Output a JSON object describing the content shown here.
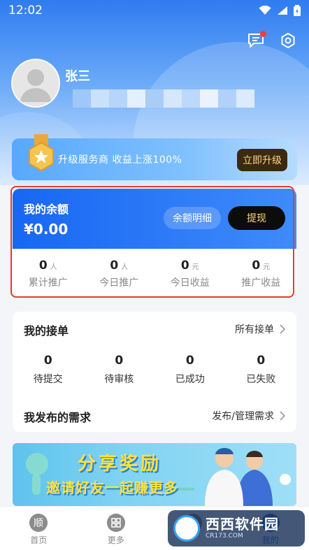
{
  "status_bar": {
    "time": "12:02"
  },
  "profile": {
    "name": "张三"
  },
  "upgrade": {
    "text": "升级服务商 收益上涨100%",
    "button": "立即升级"
  },
  "balance": {
    "title": "我的余额",
    "amount": "¥0.00",
    "detail_button": "余额明细",
    "withdraw_button": "提现",
    "stats": [
      {
        "value": "0",
        "unit": "人",
        "label": "累计推广"
      },
      {
        "value": "0",
        "unit": "人",
        "label": "今日推广"
      },
      {
        "value": "0",
        "unit": "元",
        "label": "今日收益"
      },
      {
        "value": "0",
        "unit": "元",
        "label": "推广收益"
      }
    ]
  },
  "orders": {
    "title": "我的接单",
    "all_link": "所有接单",
    "stats": [
      {
        "value": "0",
        "label": "待提交"
      },
      {
        "value": "0",
        "label": "待审核"
      },
      {
        "value": "0",
        "label": "已成功"
      },
      {
        "value": "0",
        "label": "已失败"
      }
    ],
    "needs_title": "我发布的需求",
    "needs_link": "发布/管理需求"
  },
  "banner": {
    "title": "分享奖励",
    "subtitle": "邀请好友一起赚更多"
  },
  "tabbar": {
    "items": [
      {
        "label": "首页",
        "icon": "home-icon"
      },
      {
        "label": "更多",
        "icon": "grid-icon"
      },
      {
        "label": "",
        "icon": "task-icon"
      },
      {
        "label": "我的",
        "icon": "user-icon"
      }
    ]
  },
  "watermark": {
    "text": "西西软件园",
    "sub": "CR173.COM"
  },
  "colors": {
    "primary": "#2f7cf0",
    "card_blue": "#1767f3",
    "frame_red": "#e53c2b",
    "gold": "#ffd97a"
  }
}
